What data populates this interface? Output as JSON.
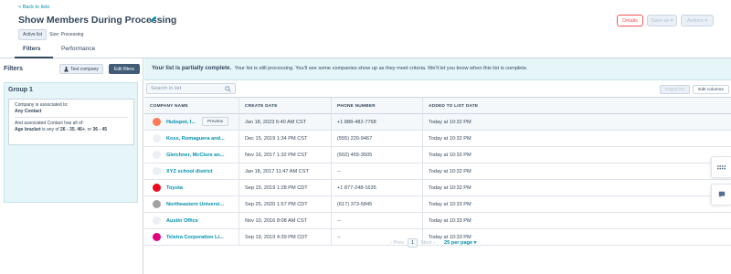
{
  "header": {
    "back_link": "< Back to lists",
    "title": "Show Members During Processing",
    "badge": "Active list",
    "size_text": "Size: Processing",
    "details_btn": "Details",
    "save_btn": "Save as ▾",
    "actions_btn": "Actions ▾"
  },
  "tabs": [
    {
      "label": "Filters",
      "active": true
    },
    {
      "label": "Performance",
      "active": false
    }
  ],
  "filters_panel": {
    "title": "Filters",
    "test_company_btn": "Test company",
    "edit_filters_btn": "Edit filters",
    "group": {
      "title": "Group 1",
      "line1": "Company is associated to:",
      "line2": "Any Contact",
      "line3": "And associated Contact has all of:",
      "prop": "Age bracket",
      "is_any_of": " is any of ",
      "v1": "26 - 35",
      "sep1": ", ",
      "v2": "46+",
      "sep2": ", or ",
      "v3": "36 - 45"
    }
  },
  "banner": {
    "strong": "Your list is partially complete.",
    "text": "Your list is still processing. You'll see some companies show up as they meet criteria. We'll let you know when this list is complete."
  },
  "search": {
    "placeholder": "Search in list"
  },
  "toolbar": {
    "export": "Export list",
    "edit_columns": "Edit columns"
  },
  "table": {
    "headers": [
      "COMPANY NAME",
      "CREATE DATE",
      "PHONE NUMBER",
      "ADDED TO LIST DATE"
    ],
    "preview_label": "Preview",
    "rows": [
      {
        "name": "Hubspot, I...",
        "create": "Jan 18, 2023 6:40 AM CST",
        "phone": "+1 888-482-7768",
        "added": "Today at 10:32 PM",
        "logo": "#ff7a59"
      },
      {
        "name": "Koss, Romaguera and...",
        "create": "Dec 15, 2019 1:34 PM CST",
        "phone": "(555) 220-9467",
        "added": "Today at 10:32 PM",
        "logo": "#eaf0f6"
      },
      {
        "name": "Gleichner, McClure an...",
        "create": "Nov 16, 2017 1:32 PM CST",
        "phone": "(502) 455-3505",
        "added": "Today at 10:32 PM",
        "logo": "#eaf0f6"
      },
      {
        "name": "XYZ school district",
        "create": "Jan 18, 2017 11:47 AM CST",
        "phone": "--",
        "added": "Today at 10:32 PM",
        "logo": "#eaf0f6"
      },
      {
        "name": "Toyota",
        "create": "Sep 15, 2019 1:28 PM CDT",
        "phone": "+1 877-248-1635",
        "added": "Today at 10:32 PM",
        "logo": "#eb0a1e"
      },
      {
        "name": "Northeastern Universi...",
        "create": "Sep 25, 2020 1:57 PM CDT",
        "phone": "(617) 373-5845",
        "added": "Today at 10:33 PM",
        "logo": "#a0a0a0"
      },
      {
        "name": "Austin Office",
        "create": "Nov 10, 2016 8:08 AM CST",
        "phone": "--",
        "added": "Today at 10:33 PM",
        "logo": "#eaf0f6"
      },
      {
        "name": "Telstra Corporation Li...",
        "create": "Sep 19, 2019 4:39 PM CDT",
        "phone": "--",
        "added": "Today at 10:33 PM",
        "logo": "#e4007f"
      }
    ]
  },
  "pagination": {
    "prev": "Prev",
    "current": "1",
    "next": "Next",
    "per_page": "25 per page ▾"
  }
}
